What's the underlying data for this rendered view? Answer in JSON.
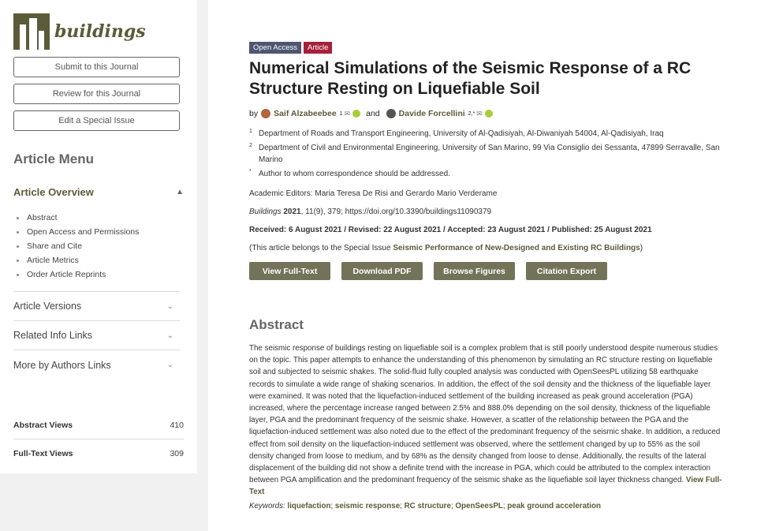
{
  "logo_text": "buildings",
  "sidebar": {
    "buttons": [
      "Submit to this Journal",
      "Review for this Journal",
      "Edit a Special Issue"
    ],
    "menu_title": "Article Menu",
    "overview_title": "Article Overview",
    "overview_items": [
      "Abstract",
      "Open Access and Permissions",
      "Share and Cite",
      "Article Metrics",
      "Order Article Reprints"
    ],
    "accordions": [
      "Article Versions",
      "Related Info Links",
      "More by Authors Links"
    ]
  },
  "stats": [
    {
      "label": "Abstract Views",
      "value": "410"
    },
    {
      "label": "Full-Text Views",
      "value": "309"
    }
  ],
  "badges": {
    "open_access": "Open Access",
    "article": "Article"
  },
  "title": "Numerical Simulations of the Seismic Response of a RC Structure Resting on Liquefiable Soil",
  "authors": {
    "by": "by",
    "a1": "Saif Alzabeebee",
    "a1_sup": "1",
    "and": "and",
    "a2": "Davide Forcellini",
    "a2_sup": "2,*"
  },
  "affiliations": [
    {
      "num": "1",
      "text": "Department of Roads and Transport Engineering, University of Al-Qadisiyah, Al-Diwaniyah 54004, Al-Qadisiyah, Iraq"
    },
    {
      "num": "2",
      "text": "Department of Civil and Environmental Engineering, University of San Marino, 99 Via Consiglio dei Sessanta, 47899 Serravalle, San Marino"
    },
    {
      "num": "*",
      "text": "Author to whom correspondence should be addressed."
    }
  ],
  "editors": "Academic Editors: Maria Teresa De Risi and Gerardo Mario Verderame",
  "citation": {
    "journal": "Buildings",
    "year": "2021",
    "rest": ", 11(9), 379; https://doi.org/10.3390/buildings11090379"
  },
  "dates": "Received: 6 August 2021 / Revised: 22 August 2021 / Accepted: 23 August 2021 / Published: 25 August 2021",
  "special_issue": {
    "prefix": "(This article belongs to the Special Issue ",
    "link": "Seismic Performance of New-Designed and Existing RC Buildings",
    "suffix": ")"
  },
  "actions": [
    "View Full-Text",
    "Download PDF",
    "Browse Figures",
    "Citation Export"
  ],
  "abstract_title": "Abstract",
  "abstract_text": "The seismic response of buildings resting on liquefiable soil is a complex problem that is still poorly understood despite numerous studies on the topic. This paper attempts to enhance the understanding of this phenomenon by simulating an RC structure resting on liquefiable soil and subjected to seismic shakes. The solid-fluid fully coupled analysis was conducted with OpenSeesPL utilizing 58 earthquake records to simulate a wide range of shaking scenarios. In addition, the effect of the soil density and the thickness of the liquefiable layer were examined. It was noted that the liquefaction-induced settlement of the building increased as peak ground acceleration (PGA) increased, where the percentage increase ranged between 2.5% and 888.0% depending on the soil density, thickness of the liquefiable layer, PGA and the predominant frequency of the seismic shake. However, a scatter of the relationship between the PGA and the liquefaction-induced settlement was also noted due to the effect of the predominant frequency of the seismic shake. In addition, a reduced effect from soil density on the liquefaction-induced settlement was observed, where the settlement changed by up to 55% as the soil density changed from loose to medium, and by 68% as the density changed from loose to dense. Additionally, the results of the lateral displacement of the building did not show a definite trend with the increase in PGA, which could be attributed to the complex interaction between PGA amplification and the predominant frequency of the seismic shake as the liquefiable soil layer thickness changed.",
  "view_full_text": "View Full-Text",
  "keywords": {
    "label": "Keywords:",
    "items": [
      "liquefaction",
      "seismic response",
      "RC structure",
      "OpenSeesPL",
      "peak ground acceleration"
    ]
  }
}
